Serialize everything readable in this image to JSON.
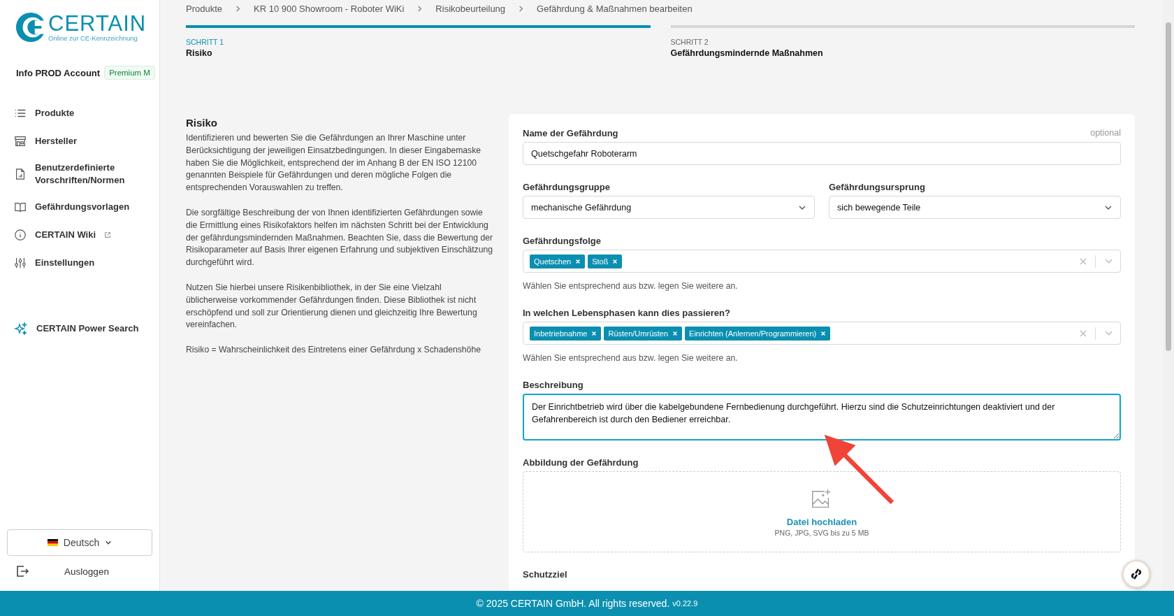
{
  "logo": {
    "name": "CERTAIN",
    "tagline": "Online zur CE-Kennzeichnung"
  },
  "account": {
    "name": "Info PROD Account",
    "badge": "Premium M"
  },
  "nav": [
    {
      "label": "Produkte",
      "external": false
    },
    {
      "label": "Hersteller",
      "external": false
    },
    {
      "label": "Benutzerdefinierte Vorschriften/Normen",
      "external": false
    },
    {
      "label": "Gefährdungsvorlagen",
      "external": false
    },
    {
      "label": "CERTAIN Wiki",
      "external": true
    },
    {
      "label": "Einstellungen",
      "external": false
    }
  ],
  "power_search": {
    "label": "CERTAIN Power Search"
  },
  "language": {
    "label": "Deutsch"
  },
  "logout": {
    "label": "Ausloggen"
  },
  "breadcrumbs": [
    "Produkte",
    "KR 10 900 Showroom - Roboter WiKi",
    "Risikobeurteilung",
    "Gefährdung & Maßnahmen bearbeiten"
  ],
  "steps": [
    {
      "step": "SCHRITT 1",
      "title": "Risiko",
      "selected": true
    },
    {
      "step": "SCHRITT 2",
      "title": "Gefährdungsmindernde Maßnahmen",
      "selected": false
    }
  ],
  "intro": {
    "title": "Risiko",
    "paragraphs": [
      "Identifizieren und bewerten Sie die Gefährdungen an Ihrer Maschine unter Berücksichtigung der jeweiligen Einsatzbedingungen. In dieser Eingabemaske haben Sie die Möglichkeit, entsprechend der im Anhang B der EN ISO 12100 genannten Beispiele für Gefährdungen und deren mögliche Folgen die entsprechenden Vorauswahlen zu treffen.",
      "Die sorgfältige Beschreibung der von Ihnen identifizierten Gefährdungen sowie die Ermittlung eines Risikofaktors helfen im nächsten Schritt bei der Entwicklung der gefährdungsmindernden Maßnahmen. Beachten Sie, dass die Bewertung der Risikoparameter auf Basis Ihrer eigenen Erfahrung und subjektiven Einschätzung durchgeführt wird.",
      "Nutzen Sie hierbei unsere Risikenbibliothek, in der Sie eine Vielzahl üblicherweise vorkommender Gefährdungen finden. Diese Bibliothek ist nicht erschöpfend und soll zur Orientierung dienen und gleichzeitig Ihre Bewertung vereinfachen.",
      "Risiko = Wahrscheinlichkeit des Eintretens einer Gefährdung x Schadenshöhe"
    ]
  },
  "form": {
    "name_field": {
      "label": "Name der Gefährdung",
      "optional": "optional",
      "value": "Quetschgefahr Roboterarm"
    },
    "selects": [
      {
        "label": "Gefährdungsgruppe",
        "value": "mechanische Gefährdung"
      },
      {
        "label": "Gefährdungsursprung",
        "value": "sich bewegende Teile"
      }
    ],
    "tag_fields": [
      {
        "label": "Gefährdungsfolge",
        "tags": [
          "Quetschen",
          "Stoß"
        ],
        "help": "Wählen Sie entsprechend aus bzw. legen Sie weitere an."
      },
      {
        "label": "In welchen Lebensphasen kann dies passieren?",
        "tags": [
          "Inbetriebnahme",
          "Rüsten/Umrüsten",
          "Einrichten (Anlernen/Programmieren)"
        ],
        "help": "Wählen Sie entsprechend aus bzw. legen Sie weitere an."
      }
    ],
    "description": {
      "label": "Beschreibung",
      "value": "Der Einrichtbetrieb wird über die kabelgebundene Fernbedienung durchgeführt. Hierzu sind die Schutzeinrichtungen deaktiviert und der Gefahrenbereich ist durch den Bediener erreichbar.",
      "focused": true
    },
    "upload": {
      "label": "Abbildung der Gefährdung",
      "link": "Datei hochladen",
      "hint": "PNG, JPG, SVG bis zu 5 MB"
    },
    "next_label": "Schutzziel"
  },
  "footer": {
    "text": "© 2025 CERTAIN GmbH. All rights reserved.",
    "version": "v0.22.9"
  }
}
